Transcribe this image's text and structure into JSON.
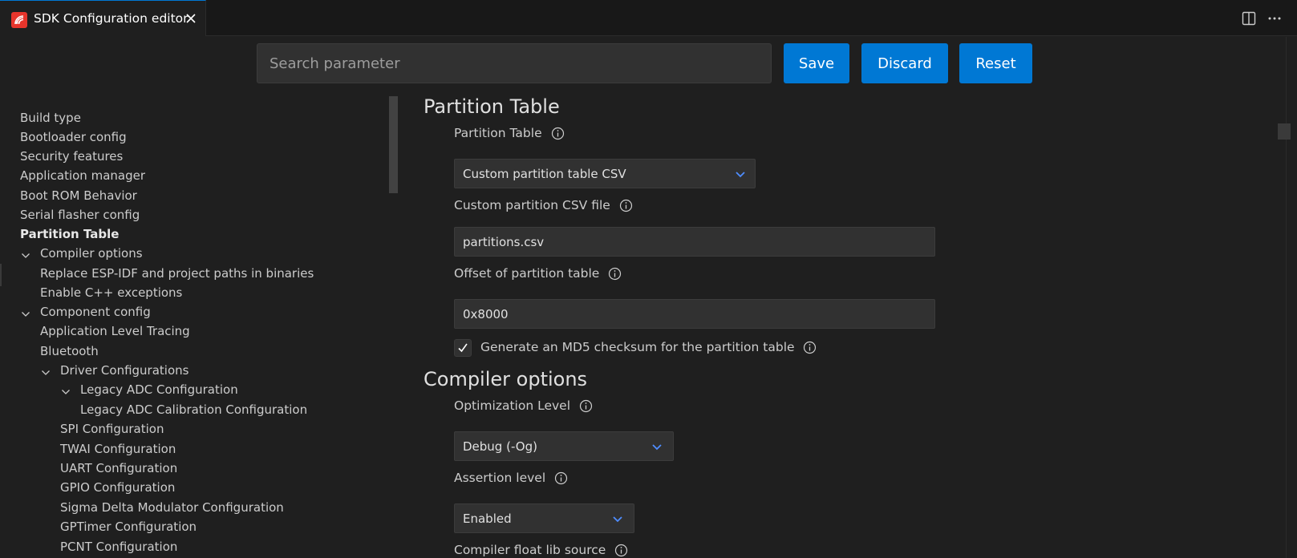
{
  "tab": {
    "title": "SDK Configuration editor",
    "icon": "espressif-logo-icon",
    "accent": "#e7352c"
  },
  "toolbar": {
    "search_placeholder": "Search parameter",
    "save_label": "Save",
    "discard_label": "Discard",
    "reset_label": "Reset",
    "button_color": "#0078d4"
  },
  "sidebar": {
    "items": [
      {
        "label": "Build type"
      },
      {
        "label": "Bootloader config"
      },
      {
        "label": "Security features"
      },
      {
        "label": "Application manager"
      },
      {
        "label": "Boot ROM Behavior"
      },
      {
        "label": "Serial flasher config"
      },
      {
        "label": "Partition Table"
      },
      {
        "label": "Compiler options"
      },
      {
        "label": "Replace ESP-IDF and project paths in binaries"
      },
      {
        "label": "Enable C++ exceptions"
      },
      {
        "label": "Component config"
      },
      {
        "label": "Application Level Tracing"
      },
      {
        "label": "Bluetooth"
      },
      {
        "label": "Driver Configurations"
      },
      {
        "label": "Legacy ADC Configuration"
      },
      {
        "label": "Legacy ADC Calibration Configuration"
      },
      {
        "label": "SPI Configuration"
      },
      {
        "label": "TWAI Configuration"
      },
      {
        "label": "UART Configuration"
      },
      {
        "label": "GPIO Configuration"
      },
      {
        "label": "Sigma Delta Modulator Configuration"
      },
      {
        "label": "GPTimer Configuration"
      },
      {
        "label": "PCNT Configuration"
      }
    ]
  },
  "main": {
    "partition_section": {
      "title": "Partition Table",
      "partition_table_label": "Partition Table",
      "partition_table_value": "Custom partition table CSV",
      "custom_csv_label": "Custom partition CSV file",
      "custom_csv_value": "partitions.csv",
      "offset_label": "Offset of partition table",
      "offset_value": "0x8000",
      "md5_label": "Generate an MD5 checksum for the partition table",
      "md5_checked": true
    },
    "compiler_section": {
      "title": "Compiler options",
      "optimization_label": "Optimization Level",
      "optimization_value": "Debug (-Og)",
      "assertion_label": "Assertion level",
      "assertion_value": "Enabled",
      "float_lib_label": "Compiler float lib source"
    }
  }
}
